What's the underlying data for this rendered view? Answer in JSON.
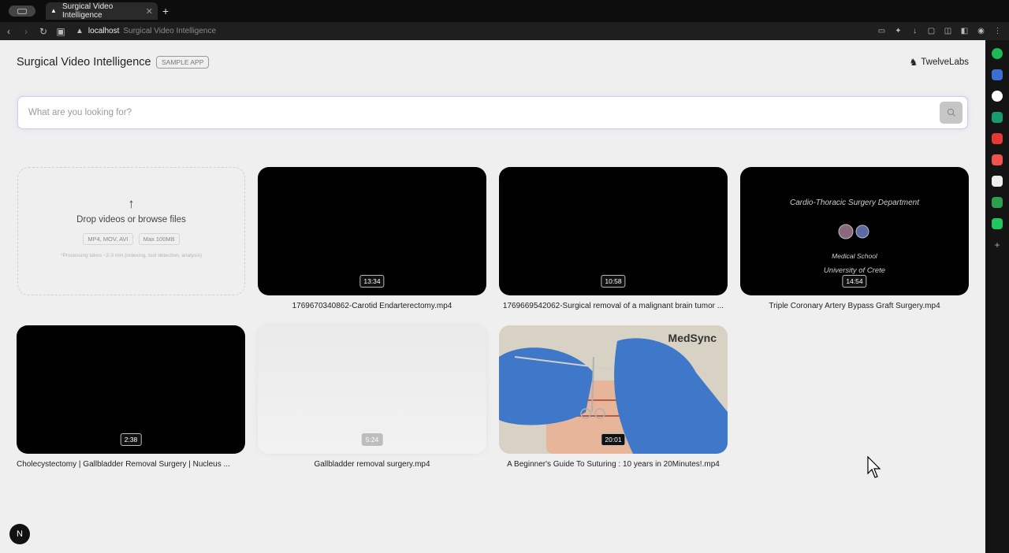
{
  "browser": {
    "tab_title": "Surgical Video Intelligence",
    "host": "localhost",
    "page_title": "Surgical Video Intelligence"
  },
  "header": {
    "title": "Surgical Video Intelligence",
    "badge": "SAMPLE APP",
    "logo_text": "TwelveLabs"
  },
  "search": {
    "placeholder": "What are you looking for?"
  },
  "upload": {
    "title": "Drop videos or browse files",
    "formats": "MP4, MOV, AVI",
    "max_size": "Max 100MB",
    "note": "*Processing takes ~2-3 min (indexing, tool detection, analysis)"
  },
  "videos": [
    {
      "duration": "13:34",
      "filename": "1769670340862-Carotid Endarterectomy.mp4"
    },
    {
      "duration": "10:58",
      "filename": "1769669542062-Surgical removal of a malignant brain tumor ..."
    },
    {
      "duration": "14:54",
      "filename": "Triple Coronary Artery Bypass Graft Surgery.mp4",
      "thumb_text": {
        "line1": "Cardio-Thoracic Surgery Department",
        "line2": "Medical School",
        "line3": "University of Crete"
      }
    },
    {
      "duration": "2:38",
      "filename": "Cholecystectomy | Gallbladder Removal Surgery | Nucleus ..."
    },
    {
      "duration": "5:24",
      "filename": "Gallbladder removal surgery.mp4"
    },
    {
      "duration": "20:01",
      "filename": "A Beginner's Guide To Suturing : 10 years in 20Minutes!.mp4",
      "thumb_text": {
        "brand": "MedSync"
      }
    }
  ],
  "dev_badge": "N"
}
